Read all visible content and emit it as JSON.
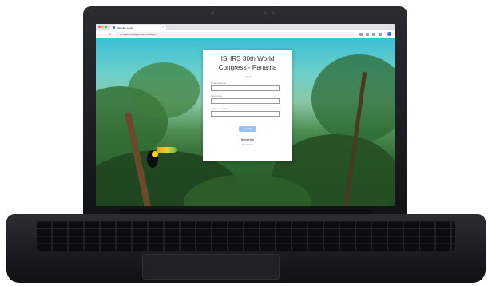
{
  "browser": {
    "tab_title": "Attendee Login",
    "tab_close": "×",
    "url": "ishrs-events.registration.com/login",
    "nav": {
      "back": "←",
      "forward": "→",
      "reload": "↻"
    }
  },
  "login": {
    "title": "ISHRS 30th World Congress - Panama",
    "subtitle": "Log in",
    "fields": [
      {
        "label": "Email address",
        "value": ""
      },
      {
        "label": "Last name",
        "value": ""
      },
      {
        "label": "Access number",
        "value": ""
      }
    ],
    "submit_label": "Submit",
    "primary_link": "Need Help",
    "secondary_link": "Contact Us"
  },
  "colors": {
    "accent": "#1a73e8",
    "button": "#9cc2f0"
  },
  "icons": [
    "close-icon",
    "back-arrow-icon",
    "forward-arrow-icon",
    "reload-icon",
    "extension-icon",
    "profile-avatar-icon"
  ]
}
